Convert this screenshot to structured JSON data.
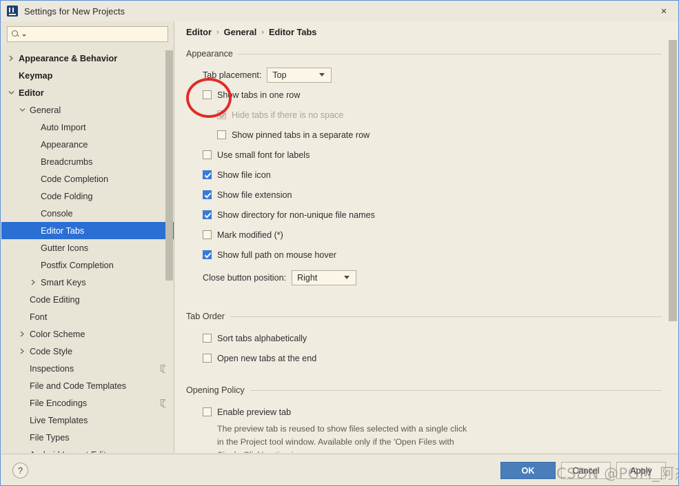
{
  "window": {
    "title": "Settings for New Projects",
    "app_icon": "intellij-idea-icon",
    "close_label": "×"
  },
  "sidebar": {
    "search": {
      "value": "",
      "placeholder": "",
      "icon": "search-icon"
    },
    "items": [
      {
        "label": "Appearance & Behavior",
        "indent": 0,
        "arrow": "right",
        "bold": true,
        "selected": false,
        "trailing_icon": null
      },
      {
        "label": "Keymap",
        "indent": 0,
        "arrow": "none",
        "bold": true,
        "selected": false,
        "trailing_icon": null
      },
      {
        "label": "Editor",
        "indent": 0,
        "arrow": "down",
        "bold": true,
        "selected": false,
        "trailing_icon": null
      },
      {
        "label": "General",
        "indent": 1,
        "arrow": "down",
        "bold": false,
        "selected": false,
        "trailing_icon": null
      },
      {
        "label": "Auto Import",
        "indent": 2,
        "arrow": "none",
        "bold": false,
        "selected": false,
        "trailing_icon": null
      },
      {
        "label": "Appearance",
        "indent": 2,
        "arrow": "none",
        "bold": false,
        "selected": false,
        "trailing_icon": null
      },
      {
        "label": "Breadcrumbs",
        "indent": 2,
        "arrow": "none",
        "bold": false,
        "selected": false,
        "trailing_icon": null
      },
      {
        "label": "Code Completion",
        "indent": 2,
        "arrow": "none",
        "bold": false,
        "selected": false,
        "trailing_icon": null
      },
      {
        "label": "Code Folding",
        "indent": 2,
        "arrow": "none",
        "bold": false,
        "selected": false,
        "trailing_icon": null
      },
      {
        "label": "Console",
        "indent": 2,
        "arrow": "none",
        "bold": false,
        "selected": false,
        "trailing_icon": null
      },
      {
        "label": "Editor Tabs",
        "indent": 2,
        "arrow": "none",
        "bold": false,
        "selected": true,
        "trailing_icon": null
      },
      {
        "label": "Gutter Icons",
        "indent": 2,
        "arrow": "none",
        "bold": false,
        "selected": false,
        "trailing_icon": null
      },
      {
        "label": "Postfix Completion",
        "indent": 2,
        "arrow": "none",
        "bold": false,
        "selected": false,
        "trailing_icon": null
      },
      {
        "label": "Smart Keys",
        "indent": 2,
        "arrow": "right",
        "bold": false,
        "selected": false,
        "trailing_icon": null
      },
      {
        "label": "Code Editing",
        "indent": 1,
        "arrow": "none",
        "bold": false,
        "selected": false,
        "trailing_icon": null
      },
      {
        "label": "Font",
        "indent": 1,
        "arrow": "none",
        "bold": false,
        "selected": false,
        "trailing_icon": null
      },
      {
        "label": "Color Scheme",
        "indent": 1,
        "arrow": "right",
        "bold": false,
        "selected": false,
        "trailing_icon": null
      },
      {
        "label": "Code Style",
        "indent": 1,
        "arrow": "right",
        "bold": false,
        "selected": false,
        "trailing_icon": null
      },
      {
        "label": "Inspections",
        "indent": 1,
        "arrow": "none",
        "bold": false,
        "selected": false,
        "trailing_icon": "copy-icon"
      },
      {
        "label": "File and Code Templates",
        "indent": 1,
        "arrow": "none",
        "bold": false,
        "selected": false,
        "trailing_icon": null
      },
      {
        "label": "File Encodings",
        "indent": 1,
        "arrow": "none",
        "bold": false,
        "selected": false,
        "trailing_icon": "copy-icon"
      },
      {
        "label": "Live Templates",
        "indent": 1,
        "arrow": "none",
        "bold": false,
        "selected": false,
        "trailing_icon": null
      },
      {
        "label": "File Types",
        "indent": 1,
        "arrow": "none",
        "bold": false,
        "selected": false,
        "trailing_icon": null
      },
      {
        "label": "Android Layout Editor",
        "indent": 1,
        "arrow": "none",
        "bold": false,
        "selected": false,
        "trailing_icon": null
      }
    ]
  },
  "breadcrumb": {
    "separator": "›",
    "crumbs": [
      "Editor",
      "General",
      "Editor Tabs"
    ]
  },
  "sections": {
    "appearance": {
      "title": "Appearance",
      "tab_placement": {
        "label": "Tab placement:",
        "value": "Top"
      },
      "close_button_position": {
        "label": "Close button position:",
        "value": "Right"
      },
      "options": [
        {
          "label": "Show tabs in one row",
          "checked": false,
          "disabled": false
        },
        {
          "label": "Hide tabs if there is no space",
          "checked": true,
          "disabled": true
        },
        {
          "label": "Show pinned tabs in a separate row",
          "checked": false,
          "disabled": false
        },
        {
          "label": "Use small font for labels",
          "checked": false,
          "disabled": false
        },
        {
          "label": "Show file icon",
          "checked": true,
          "disabled": false
        },
        {
          "label": "Show file extension",
          "checked": true,
          "disabled": false
        },
        {
          "label": "Show directory for non-unique file names",
          "checked": true,
          "disabled": false
        },
        {
          "label": "Mark modified (*)",
          "checked": false,
          "disabled": false
        },
        {
          "label": "Show full path on mouse hover",
          "checked": true,
          "disabled": false
        }
      ]
    },
    "tab_order": {
      "title": "Tab Order",
      "options": [
        {
          "label": "Sort tabs alphabetically",
          "checked": false,
          "disabled": false
        },
        {
          "label": "Open new tabs at the end",
          "checked": false,
          "disabled": false
        }
      ]
    },
    "opening_policy": {
      "title": "Opening Policy",
      "options": [
        {
          "label": "Enable preview tab",
          "checked": false,
          "disabled": false
        }
      ],
      "description": "The preview tab is reused to show files selected with a single click\nin the Project tool window. Available only if the 'Open Files with\nSingle Click' option is on."
    }
  },
  "footer": {
    "help_label": "?",
    "ok_label": "OK",
    "cancel_label": "Cancel",
    "apply_label": "Apply"
  },
  "watermark": {
    "text": "CSDN @PGM_阿杰"
  },
  "colors": {
    "accent_blue": "#2b6fd4",
    "ok_button": "#4a7ebb",
    "checkbox_checked": "#3a7ad9",
    "annotation_red": "#e02b2b",
    "window_bg": "#ece8dc",
    "content_bg": "#f0ece0"
  }
}
